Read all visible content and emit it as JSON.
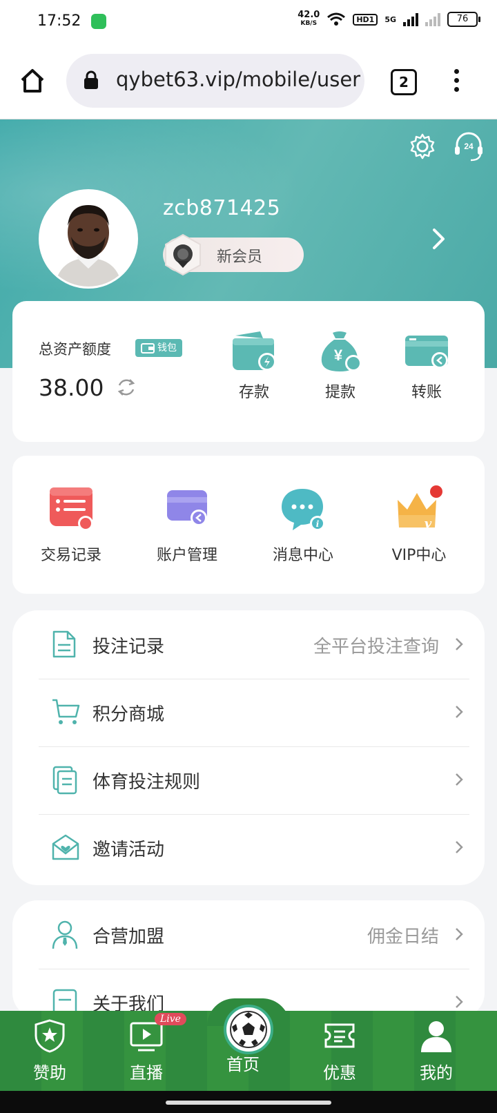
{
  "status_bar": {
    "time": "17:52",
    "net_speed": "42.0",
    "net_unit": "KB/S",
    "hd": "HD1",
    "network": "5G",
    "battery": "76"
  },
  "browser": {
    "url": "qybet63.vip/mobile/user",
    "tab_count": "2"
  },
  "profile": {
    "username": "zcb871425",
    "level": "新会员"
  },
  "assets": {
    "title": "总资产额度",
    "wallet_label": "钱包",
    "amount": "38.00",
    "actions": [
      {
        "label": "存款",
        "icon": "deposit-wallet-icon"
      },
      {
        "label": "提款",
        "icon": "withdraw-moneybag-icon"
      },
      {
        "label": "转账",
        "icon": "transfer-card-icon"
      }
    ]
  },
  "quick_links": [
    {
      "label": "交易记录",
      "icon": "transaction-record-icon"
    },
    {
      "label": "账户管理",
      "icon": "account-card-icon"
    },
    {
      "label": "消息中心",
      "icon": "message-bubble-icon"
    },
    {
      "label": "VIP中心",
      "icon": "vip-crown-icon"
    }
  ],
  "menu1": [
    {
      "label": "投注记录",
      "sub": "全平台投注查询",
      "icon": "document-icon"
    },
    {
      "label": "积分商城",
      "sub": "",
      "icon": "cart-icon"
    },
    {
      "label": "体育投注规则",
      "sub": "",
      "icon": "rules-icon"
    },
    {
      "label": "邀请活动",
      "sub": "",
      "icon": "invite-envelope-icon"
    }
  ],
  "menu2": [
    {
      "label": "合营加盟",
      "sub": "佣金日结",
      "icon": "agent-person-icon"
    },
    {
      "label": "关于我们",
      "sub": "",
      "icon": "about-icon"
    }
  ],
  "tabbar": {
    "items": [
      {
        "label": "赞助",
        "icon": "shield-star-icon"
      },
      {
        "label": "直播",
        "icon": "tv-play-icon"
      },
      {
        "label": "首页",
        "icon": "soccer-ball-icon"
      },
      {
        "label": "优惠",
        "icon": "ticket-icon"
      },
      {
        "label": "我的",
        "icon": "user-icon"
      }
    ],
    "live_badge": "Live"
  },
  "colors": {
    "accent": "#4fb3ac",
    "header": "#5ab6b1",
    "tabbar": "#2f8a3e"
  }
}
